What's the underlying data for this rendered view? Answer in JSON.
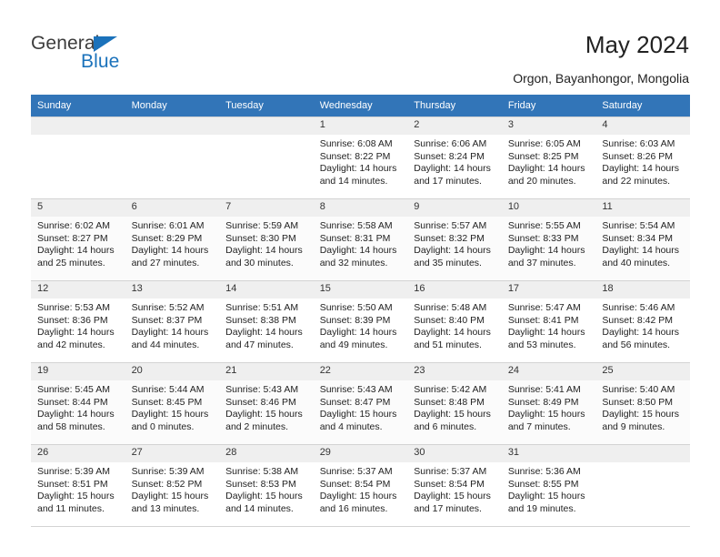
{
  "brand": {
    "name_top": "General",
    "name_bottom": "Blue",
    "accent_color": "#1b72bb"
  },
  "header": {
    "title": "May 2024",
    "subtitle": "Orgon, Bayanhongor, Mongolia"
  },
  "calendar": {
    "header_bg": "#3275b8",
    "daynum_bg": "#efefef",
    "weekday_names": [
      "Sunday",
      "Monday",
      "Tuesday",
      "Wednesday",
      "Thursday",
      "Friday",
      "Saturday"
    ],
    "labels": {
      "sunrise": "Sunrise:",
      "sunset": "Sunset:",
      "daylight": "Daylight:"
    },
    "weeks": [
      [
        {
          "day": "",
          "empty": true
        },
        {
          "day": "",
          "empty": true
        },
        {
          "day": "",
          "empty": true
        },
        {
          "day": "1",
          "sunrise": "Sunrise: 6:08 AM",
          "sunset": "Sunset: 8:22 PM",
          "daylight_line1": "Daylight: 14 hours",
          "daylight_line2": "and 14 minutes."
        },
        {
          "day": "2",
          "sunrise": "Sunrise: 6:06 AM",
          "sunset": "Sunset: 8:24 PM",
          "daylight_line1": "Daylight: 14 hours",
          "daylight_line2": "and 17 minutes."
        },
        {
          "day": "3",
          "sunrise": "Sunrise: 6:05 AM",
          "sunset": "Sunset: 8:25 PM",
          "daylight_line1": "Daylight: 14 hours",
          "daylight_line2": "and 20 minutes."
        },
        {
          "day": "4",
          "sunrise": "Sunrise: 6:03 AM",
          "sunset": "Sunset: 8:26 PM",
          "daylight_line1": "Daylight: 14 hours",
          "daylight_line2": "and 22 minutes."
        }
      ],
      [
        {
          "day": "5",
          "sunrise": "Sunrise: 6:02 AM",
          "sunset": "Sunset: 8:27 PM",
          "daylight_line1": "Daylight: 14 hours",
          "daylight_line2": "and 25 minutes."
        },
        {
          "day": "6",
          "sunrise": "Sunrise: 6:01 AM",
          "sunset": "Sunset: 8:29 PM",
          "daylight_line1": "Daylight: 14 hours",
          "daylight_line2": "and 27 minutes."
        },
        {
          "day": "7",
          "sunrise": "Sunrise: 5:59 AM",
          "sunset": "Sunset: 8:30 PM",
          "daylight_line1": "Daylight: 14 hours",
          "daylight_line2": "and 30 minutes."
        },
        {
          "day": "8",
          "sunrise": "Sunrise: 5:58 AM",
          "sunset": "Sunset: 8:31 PM",
          "daylight_line1": "Daylight: 14 hours",
          "daylight_line2": "and 32 minutes."
        },
        {
          "day": "9",
          "sunrise": "Sunrise: 5:57 AM",
          "sunset": "Sunset: 8:32 PM",
          "daylight_line1": "Daylight: 14 hours",
          "daylight_line2": "and 35 minutes."
        },
        {
          "day": "10",
          "sunrise": "Sunrise: 5:55 AM",
          "sunset": "Sunset: 8:33 PM",
          "daylight_line1": "Daylight: 14 hours",
          "daylight_line2": "and 37 minutes."
        },
        {
          "day": "11",
          "sunrise": "Sunrise: 5:54 AM",
          "sunset": "Sunset: 8:34 PM",
          "daylight_line1": "Daylight: 14 hours",
          "daylight_line2": "and 40 minutes."
        }
      ],
      [
        {
          "day": "12",
          "sunrise": "Sunrise: 5:53 AM",
          "sunset": "Sunset: 8:36 PM",
          "daylight_line1": "Daylight: 14 hours",
          "daylight_line2": "and 42 minutes."
        },
        {
          "day": "13",
          "sunrise": "Sunrise: 5:52 AM",
          "sunset": "Sunset: 8:37 PM",
          "daylight_line1": "Daylight: 14 hours",
          "daylight_line2": "and 44 minutes."
        },
        {
          "day": "14",
          "sunrise": "Sunrise: 5:51 AM",
          "sunset": "Sunset: 8:38 PM",
          "daylight_line1": "Daylight: 14 hours",
          "daylight_line2": "and 47 minutes."
        },
        {
          "day": "15",
          "sunrise": "Sunrise: 5:50 AM",
          "sunset": "Sunset: 8:39 PM",
          "daylight_line1": "Daylight: 14 hours",
          "daylight_line2": "and 49 minutes."
        },
        {
          "day": "16",
          "sunrise": "Sunrise: 5:48 AM",
          "sunset": "Sunset: 8:40 PM",
          "daylight_line1": "Daylight: 14 hours",
          "daylight_line2": "and 51 minutes."
        },
        {
          "day": "17",
          "sunrise": "Sunrise: 5:47 AM",
          "sunset": "Sunset: 8:41 PM",
          "daylight_line1": "Daylight: 14 hours",
          "daylight_line2": "and 53 minutes."
        },
        {
          "day": "18",
          "sunrise": "Sunrise: 5:46 AM",
          "sunset": "Sunset: 8:42 PM",
          "daylight_line1": "Daylight: 14 hours",
          "daylight_line2": "and 56 minutes."
        }
      ],
      [
        {
          "day": "19",
          "sunrise": "Sunrise: 5:45 AM",
          "sunset": "Sunset: 8:44 PM",
          "daylight_line1": "Daylight: 14 hours",
          "daylight_line2": "and 58 minutes."
        },
        {
          "day": "20",
          "sunrise": "Sunrise: 5:44 AM",
          "sunset": "Sunset: 8:45 PM",
          "daylight_line1": "Daylight: 15 hours",
          "daylight_line2": "and 0 minutes."
        },
        {
          "day": "21",
          "sunrise": "Sunrise: 5:43 AM",
          "sunset": "Sunset: 8:46 PM",
          "daylight_line1": "Daylight: 15 hours",
          "daylight_line2": "and 2 minutes."
        },
        {
          "day": "22",
          "sunrise": "Sunrise: 5:43 AM",
          "sunset": "Sunset: 8:47 PM",
          "daylight_line1": "Daylight: 15 hours",
          "daylight_line2": "and 4 minutes."
        },
        {
          "day": "23",
          "sunrise": "Sunrise: 5:42 AM",
          "sunset": "Sunset: 8:48 PM",
          "daylight_line1": "Daylight: 15 hours",
          "daylight_line2": "and 6 minutes."
        },
        {
          "day": "24",
          "sunrise": "Sunrise: 5:41 AM",
          "sunset": "Sunset: 8:49 PM",
          "daylight_line1": "Daylight: 15 hours",
          "daylight_line2": "and 7 minutes."
        },
        {
          "day": "25",
          "sunrise": "Sunrise: 5:40 AM",
          "sunset": "Sunset: 8:50 PM",
          "daylight_line1": "Daylight: 15 hours",
          "daylight_line2": "and 9 minutes."
        }
      ],
      [
        {
          "day": "26",
          "sunrise": "Sunrise: 5:39 AM",
          "sunset": "Sunset: 8:51 PM",
          "daylight_line1": "Daylight: 15 hours",
          "daylight_line2": "and 11 minutes."
        },
        {
          "day": "27",
          "sunrise": "Sunrise: 5:39 AM",
          "sunset": "Sunset: 8:52 PM",
          "daylight_line1": "Daylight: 15 hours",
          "daylight_line2": "and 13 minutes."
        },
        {
          "day": "28",
          "sunrise": "Sunrise: 5:38 AM",
          "sunset": "Sunset: 8:53 PM",
          "daylight_line1": "Daylight: 15 hours",
          "daylight_line2": "and 14 minutes."
        },
        {
          "day": "29",
          "sunrise": "Sunrise: 5:37 AM",
          "sunset": "Sunset: 8:54 PM",
          "daylight_line1": "Daylight: 15 hours",
          "daylight_line2": "and 16 minutes."
        },
        {
          "day": "30",
          "sunrise": "Sunrise: 5:37 AM",
          "sunset": "Sunset: 8:54 PM",
          "daylight_line1": "Daylight: 15 hours",
          "daylight_line2": "and 17 minutes."
        },
        {
          "day": "31",
          "sunrise": "Sunrise: 5:36 AM",
          "sunset": "Sunset: 8:55 PM",
          "daylight_line1": "Daylight: 15 hours",
          "daylight_line2": "and 19 minutes."
        },
        {
          "day": "",
          "empty": true
        }
      ]
    ]
  }
}
